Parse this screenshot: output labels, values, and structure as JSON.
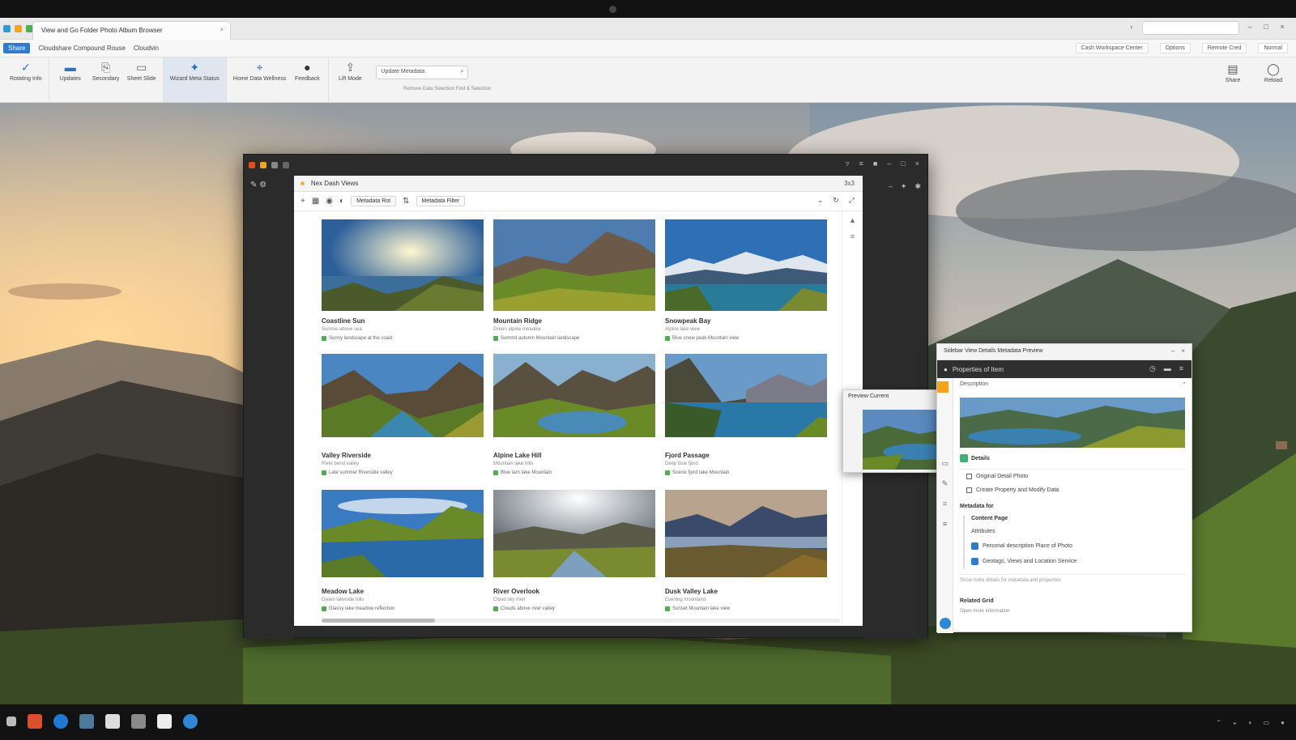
{
  "colors": {
    "accent": "#2e7bd4",
    "taskbar": "#121212",
    "window_dark": "#2b2b2b"
  },
  "app": {
    "tab_title": "View and Go Folder Photo Album Browser",
    "menu": {
      "file_badge": "Share",
      "items": [
        "Cloudshare Compound Rouse",
        "Cloudvin"
      ],
      "right": [
        "Cash Workspace Center",
        "Options",
        "Remote Cred",
        "Normal"
      ]
    },
    "ribbon": {
      "buttons": [
        {
          "label": "Rotating Info",
          "icon": "check-icon"
        },
        {
          "label": "Updates",
          "icon": "folder-icon"
        },
        {
          "label": "Secondary",
          "icon": "share-icon"
        },
        {
          "label": "Sheet Slide",
          "icon": "slideshow-icon"
        },
        {
          "label": "Wizard Meta Status",
          "icon": "wizard-icon"
        },
        {
          "label": "Home Data Wellness",
          "icon": "location-pin-icon"
        },
        {
          "label": "Feedback",
          "icon": "info-icon"
        },
        {
          "label": "Lift Mode",
          "icon": "lift-icon"
        }
      ],
      "search_text": "Update Metadata",
      "caption": "Remove Data Selection Find & Selection",
      "right_buttons": [
        "Share",
        "Reload"
      ]
    }
  },
  "gallery": {
    "header_title": "Nex Dash Views",
    "count": "3x3",
    "toolbar": {
      "btn1": "Metadata Rot",
      "btn2": "Metadata Filter"
    },
    "cards": [
      {
        "title": "Coastline Sun",
        "subtitle": "Sunrise above sea",
        "meta": "Sunny landscape at the coast"
      },
      {
        "title": "Mountain Ridge",
        "subtitle": "Green alpine meadow",
        "meta": "Summit autumn Mountain landscape"
      },
      {
        "title": "Snowpeak Bay",
        "subtitle": "Alpine lake view",
        "meta": "Blue snow peak Mountain view"
      },
      {
        "title": "Valley Riverside",
        "subtitle": "River bend valley",
        "meta": "Late summer Riverside valley"
      },
      {
        "title": "Alpine Lake Hill",
        "subtitle": "Mountain lake hills",
        "meta": "Blue tarn lake Mountain"
      },
      {
        "title": "Fjord Passage",
        "subtitle": "Deep blue fjord",
        "meta": "Scenic fjord lake Mountain"
      },
      {
        "title": "Meadow Lake",
        "subtitle": "Green lakeside hills",
        "meta": "Glassy lake meadow reflection"
      },
      {
        "title": "River Overlook",
        "subtitle": "Cloud sky river",
        "meta": "Clouds above river valley"
      },
      {
        "title": "Dusk Valley Lake",
        "subtitle": "Evening mountains",
        "meta": "Sunset Mountain lake view"
      }
    ]
  },
  "float_preview": {
    "title": "Preview Current"
  },
  "details": {
    "title": "Sidebar View Details Metadata Preview",
    "header": "Properties of Item",
    "subheader": "Description",
    "section": "Details",
    "rows": [
      "Original Detail Photo",
      "Create Property and Modify Data"
    ],
    "heading": "Metadata for",
    "sub_title": "Content Page",
    "sub_caption": "Attributes",
    "sub_rows": [
      "Personal description Place of Photo",
      "Geotags, Views and Location Service"
    ],
    "footer": "Show more details for metadata and properties",
    "bottom_title": "Related Grid",
    "bottom_sub": "Open more information"
  },
  "taskbar": {
    "apps": [
      "file-explorer-icon",
      "browser-icon",
      "store-icon",
      "photos-icon",
      "calendar-icon",
      "camera-icon",
      "edge-icon"
    ]
  }
}
